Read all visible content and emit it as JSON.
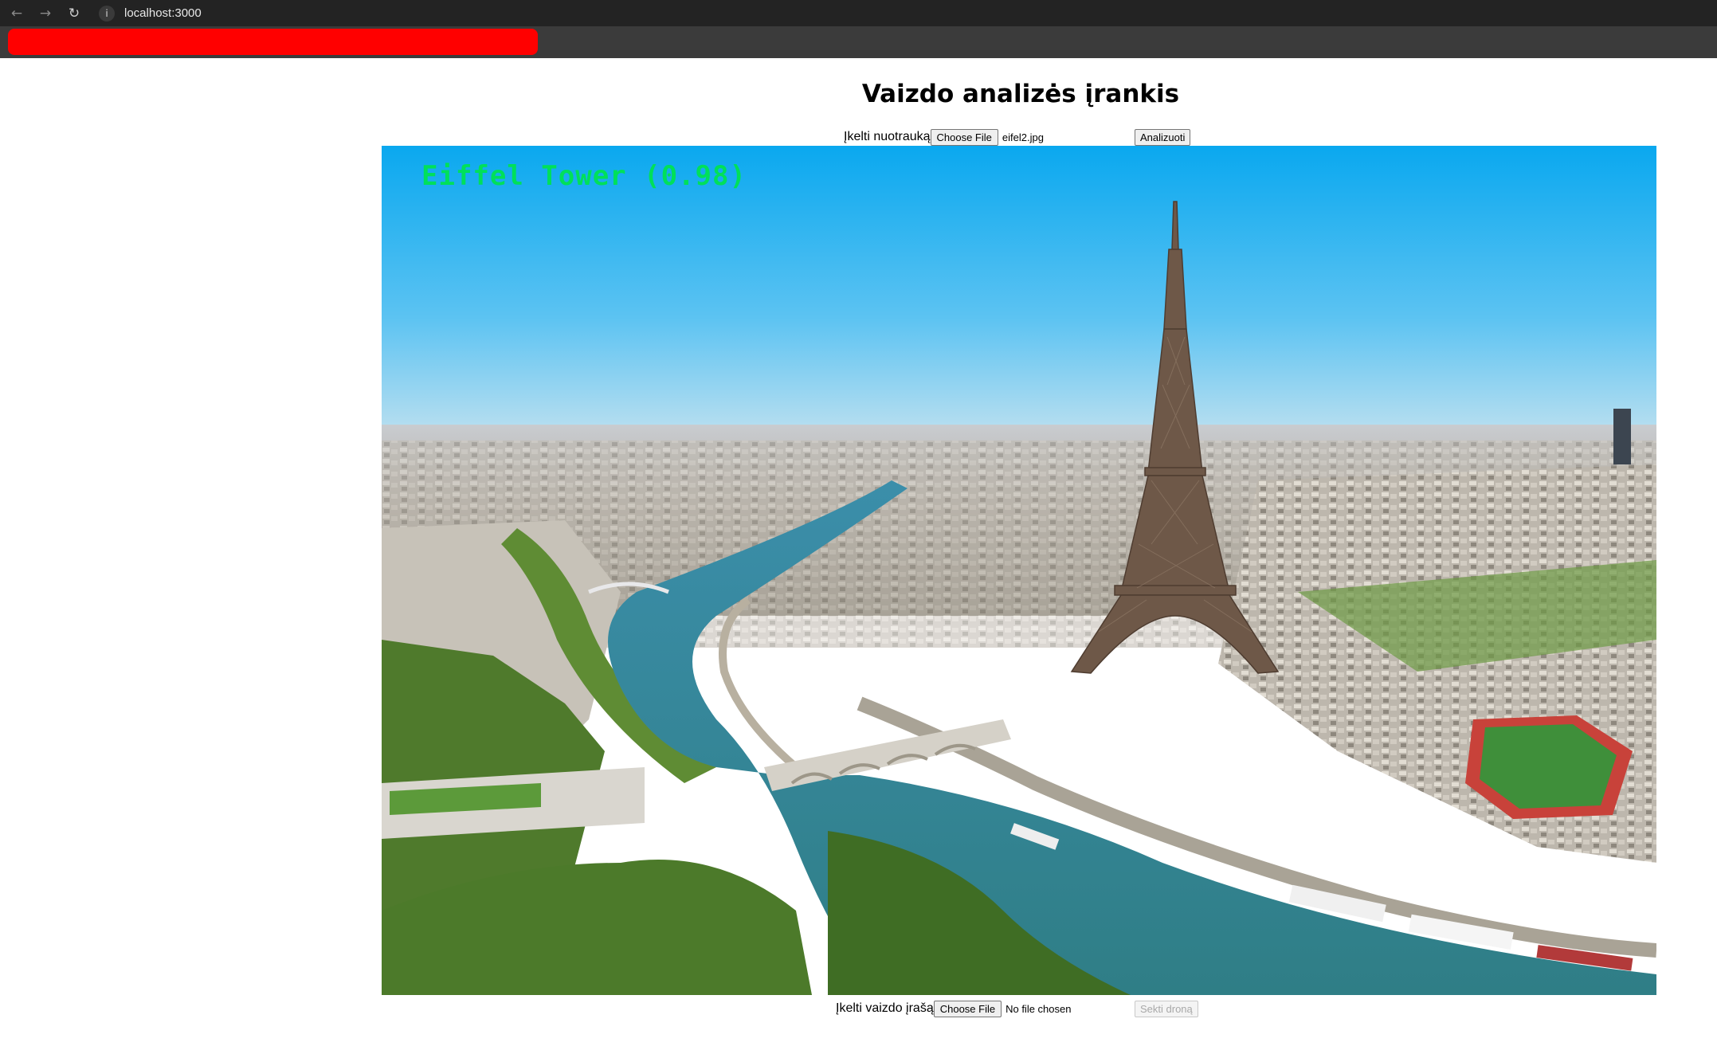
{
  "browser": {
    "url": "localhost:3000",
    "icons": {
      "back": "arrow-left-icon",
      "forward": "arrow-right-icon",
      "reload": "reload-icon",
      "site_info": "info-icon"
    }
  },
  "page": {
    "title": "Vaizdo analizės įrankis"
  },
  "photo_upload": {
    "label": "Įkelti nuotrauką",
    "choose_label": "Choose File",
    "file_name": "eifel2.jpg",
    "analyze_label": "Analizuoti"
  },
  "result": {
    "detection_label": "Eiffel Tower (0.98)",
    "label_color": "#00e05a"
  },
  "video_upload": {
    "label": "Įkelti vaizdo įrašą",
    "choose_label": "Choose File",
    "file_name": "No file chosen",
    "drone_label": "Sekti droną"
  }
}
